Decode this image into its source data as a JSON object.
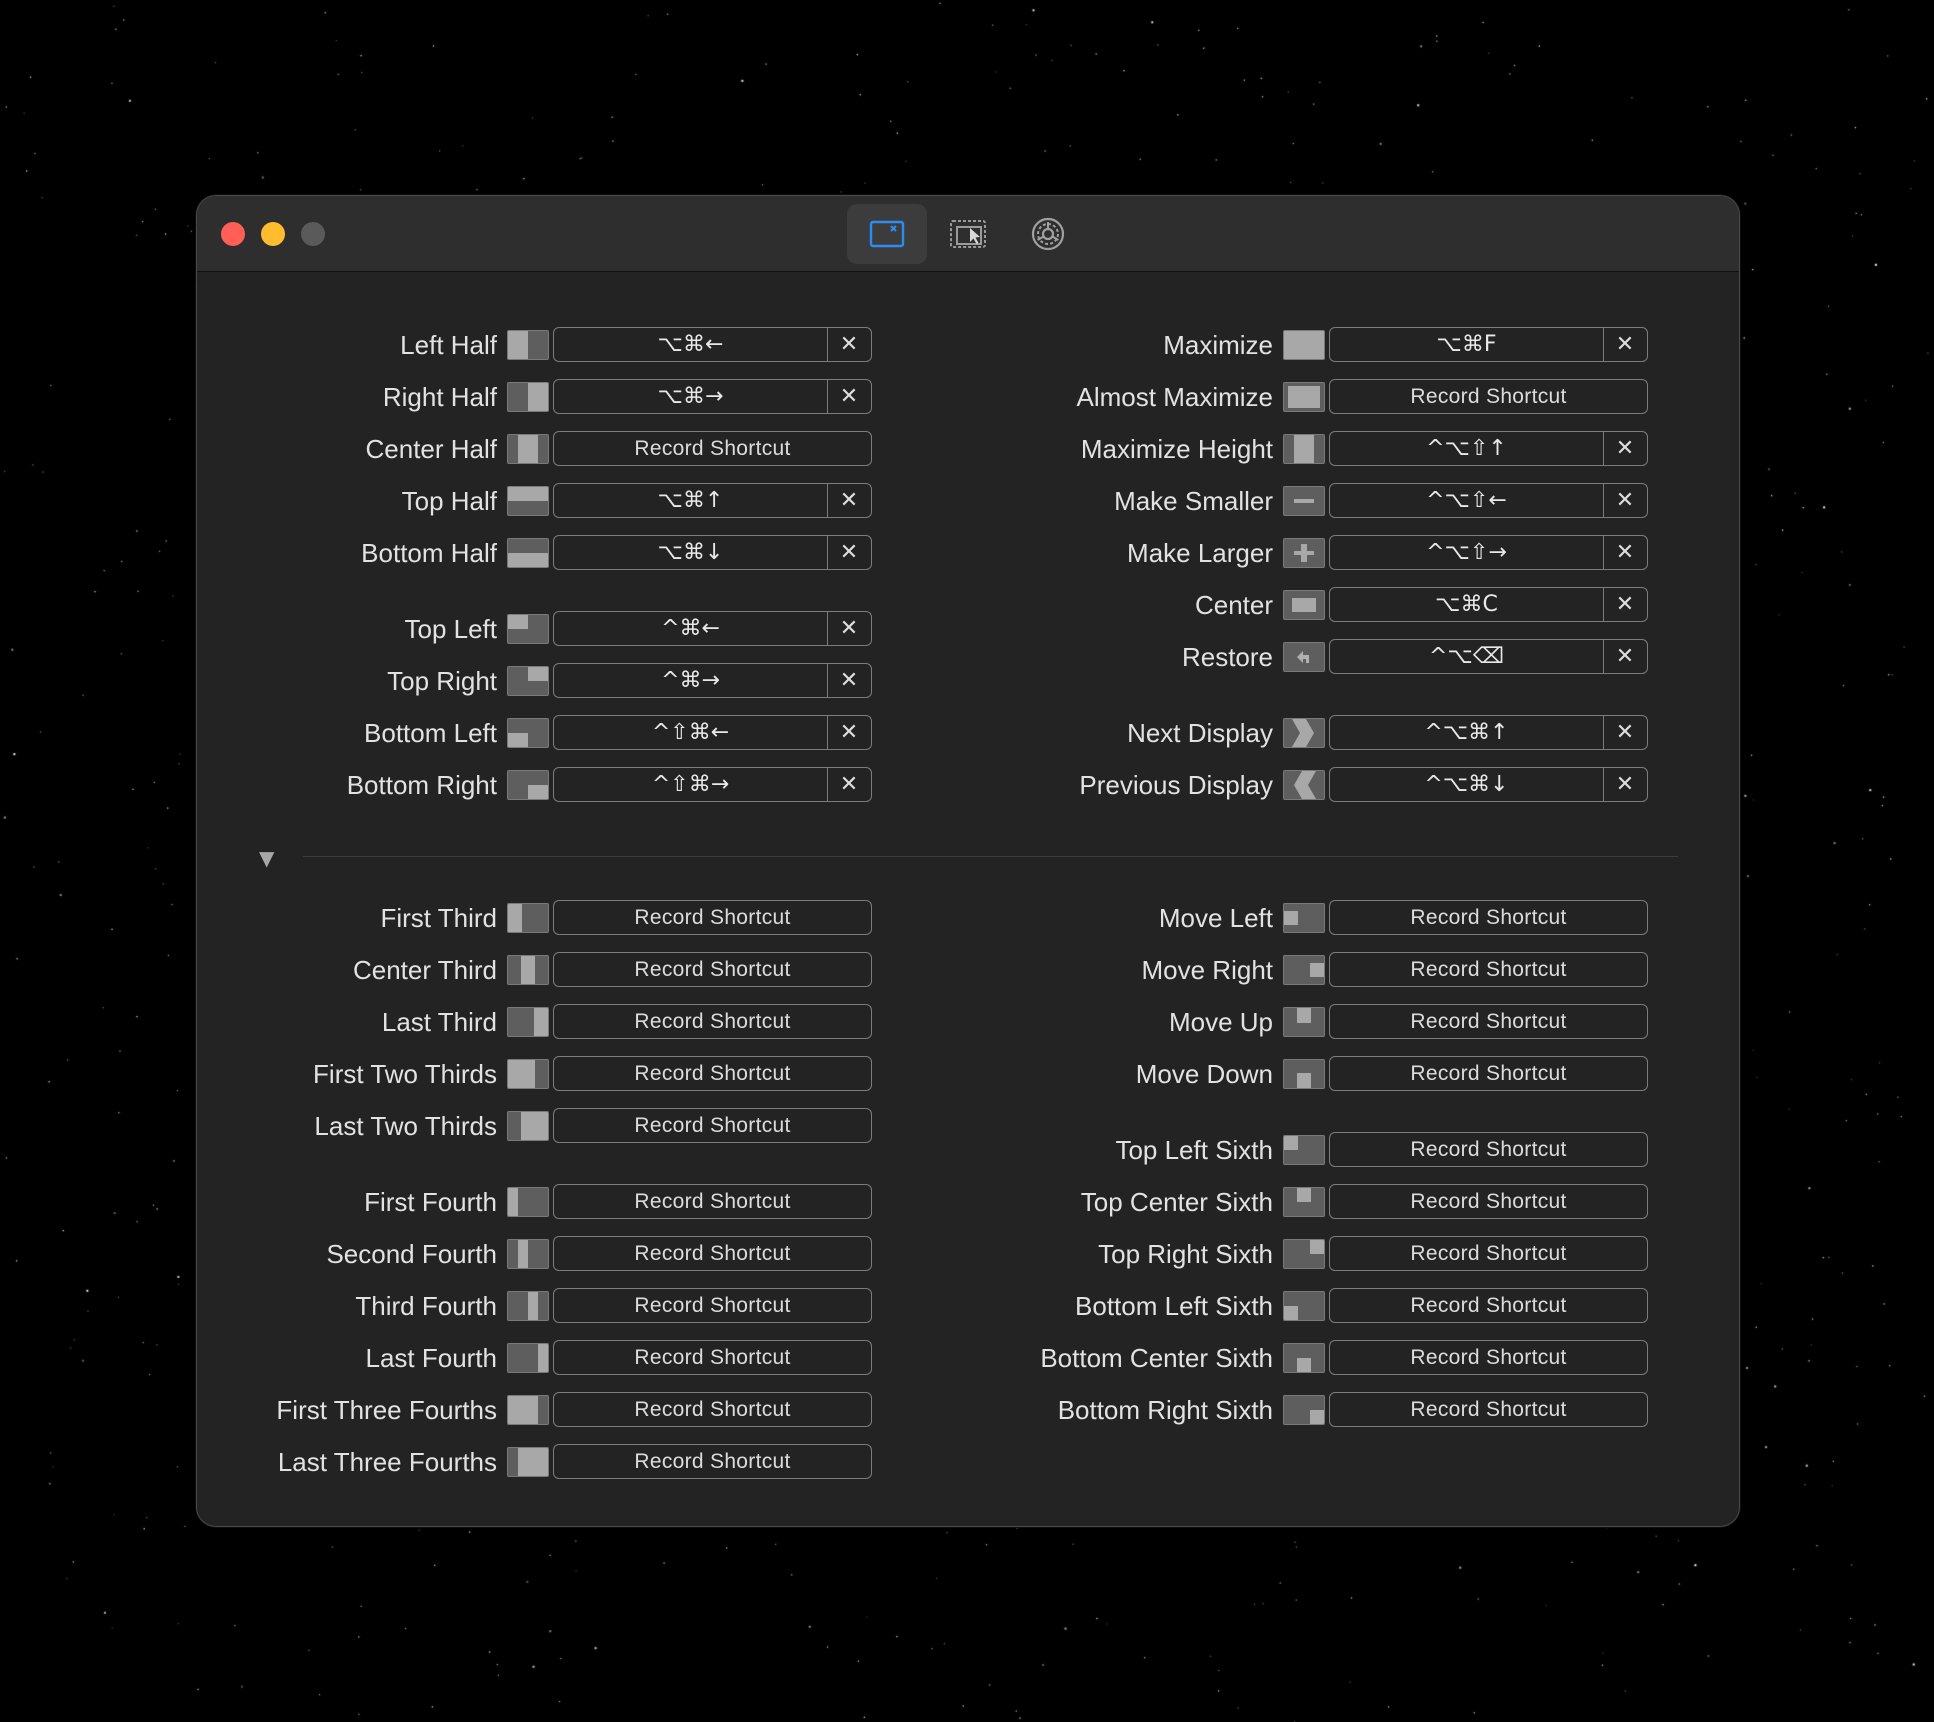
{
  "window": {
    "tabs": [
      {
        "name": "window-shortcuts-tab",
        "icon": "window-snap-icon",
        "active": true
      },
      {
        "name": "snap-areas-tab",
        "icon": "cursor-window-icon",
        "active": false
      },
      {
        "name": "settings-tab",
        "icon": "gear-icon",
        "active": false
      }
    ]
  },
  "colors": {
    "accent": "#2b8cf6",
    "close": "#ff5f57",
    "minimize": "#febc2e"
  },
  "record_label": "Record Shortcut",
  "clear_glyph": "✕",
  "disclosure_glyph": "▼",
  "left_top": [
    {
      "label": "Left Half",
      "icon": "left-half",
      "keys": "⌥⌘←"
    },
    {
      "label": "Right Half",
      "icon": "right-half",
      "keys": "⌥⌘→"
    },
    {
      "label": "Center Half",
      "icon": "center-half",
      "keys": ""
    },
    {
      "label": "Top Half",
      "icon": "top-half",
      "keys": "⌥⌘↑"
    },
    {
      "label": "Bottom Half",
      "icon": "bottom-half",
      "keys": "⌥⌘↓"
    },
    {
      "label": "Top Left",
      "icon": "top-left",
      "keys": "^⌘←"
    },
    {
      "label": "Top Right",
      "icon": "top-right",
      "keys": "^⌘→"
    },
    {
      "label": "Bottom Left",
      "icon": "bottom-left",
      "keys": "^⇧⌘←"
    },
    {
      "label": "Bottom Right",
      "icon": "bottom-right",
      "keys": "^⇧⌘→"
    }
  ],
  "right_top": [
    {
      "label": "Maximize",
      "icon": "maximize",
      "keys": "⌥⌘F"
    },
    {
      "label": "Almost Maximize",
      "icon": "almost-maximize",
      "keys": ""
    },
    {
      "label": "Maximize Height",
      "icon": "maximize-height",
      "keys": "^⌥⇧↑"
    },
    {
      "label": "Make Smaller",
      "icon": "make-smaller",
      "keys": "^⌥⇧←"
    },
    {
      "label": "Make Larger",
      "icon": "make-larger",
      "keys": "^⌥⇧→"
    },
    {
      "label": "Center",
      "icon": "center",
      "keys": "⌥⌘C"
    },
    {
      "label": "Restore",
      "icon": "restore",
      "keys": "^⌥⌫"
    },
    {
      "label": "Next Display",
      "icon": "next-display",
      "keys": "^⌥⌘↑"
    },
    {
      "label": "Previous Display",
      "icon": "previous-display",
      "keys": "^⌥⌘↓"
    }
  ],
  "left_bottom": [
    {
      "label": "First Third",
      "icon": "first-third",
      "keys": ""
    },
    {
      "label": "Center Third",
      "icon": "center-third",
      "keys": ""
    },
    {
      "label": "Last Third",
      "icon": "last-third",
      "keys": ""
    },
    {
      "label": "First Two Thirds",
      "icon": "first-two-thirds",
      "keys": ""
    },
    {
      "label": "Last Two Thirds",
      "icon": "last-two-thirds",
      "keys": ""
    },
    {
      "label": "First Fourth",
      "icon": "first-fourth",
      "keys": ""
    },
    {
      "label": "Second Fourth",
      "icon": "second-fourth",
      "keys": ""
    },
    {
      "label": "Third Fourth",
      "icon": "third-fourth",
      "keys": ""
    },
    {
      "label": "Last Fourth",
      "icon": "last-fourth",
      "keys": ""
    },
    {
      "label": "First Three Fourths",
      "icon": "first-three-fourths",
      "keys": ""
    },
    {
      "label": "Last Three Fourths",
      "icon": "last-three-fourths",
      "keys": ""
    }
  ],
  "right_bottom": [
    {
      "label": "Move Left",
      "icon": "move-left",
      "keys": ""
    },
    {
      "label": "Move Right",
      "icon": "move-right",
      "keys": ""
    },
    {
      "label": "Move Up",
      "icon": "move-up",
      "keys": ""
    },
    {
      "label": "Move Down",
      "icon": "move-down",
      "keys": ""
    },
    {
      "label": "Top Left Sixth",
      "icon": "top-left-sixth",
      "keys": ""
    },
    {
      "label": "Top Center Sixth",
      "icon": "top-center-sixth",
      "keys": ""
    },
    {
      "label": "Top Right Sixth",
      "icon": "top-right-sixth",
      "keys": ""
    },
    {
      "label": "Bottom Left Sixth",
      "icon": "bottom-left-sixth",
      "keys": ""
    },
    {
      "label": "Bottom Center Sixth",
      "icon": "bottom-center-sixth",
      "keys": ""
    },
    {
      "label": "Bottom Right Sixth",
      "icon": "bottom-right-sixth",
      "keys": ""
    }
  ]
}
